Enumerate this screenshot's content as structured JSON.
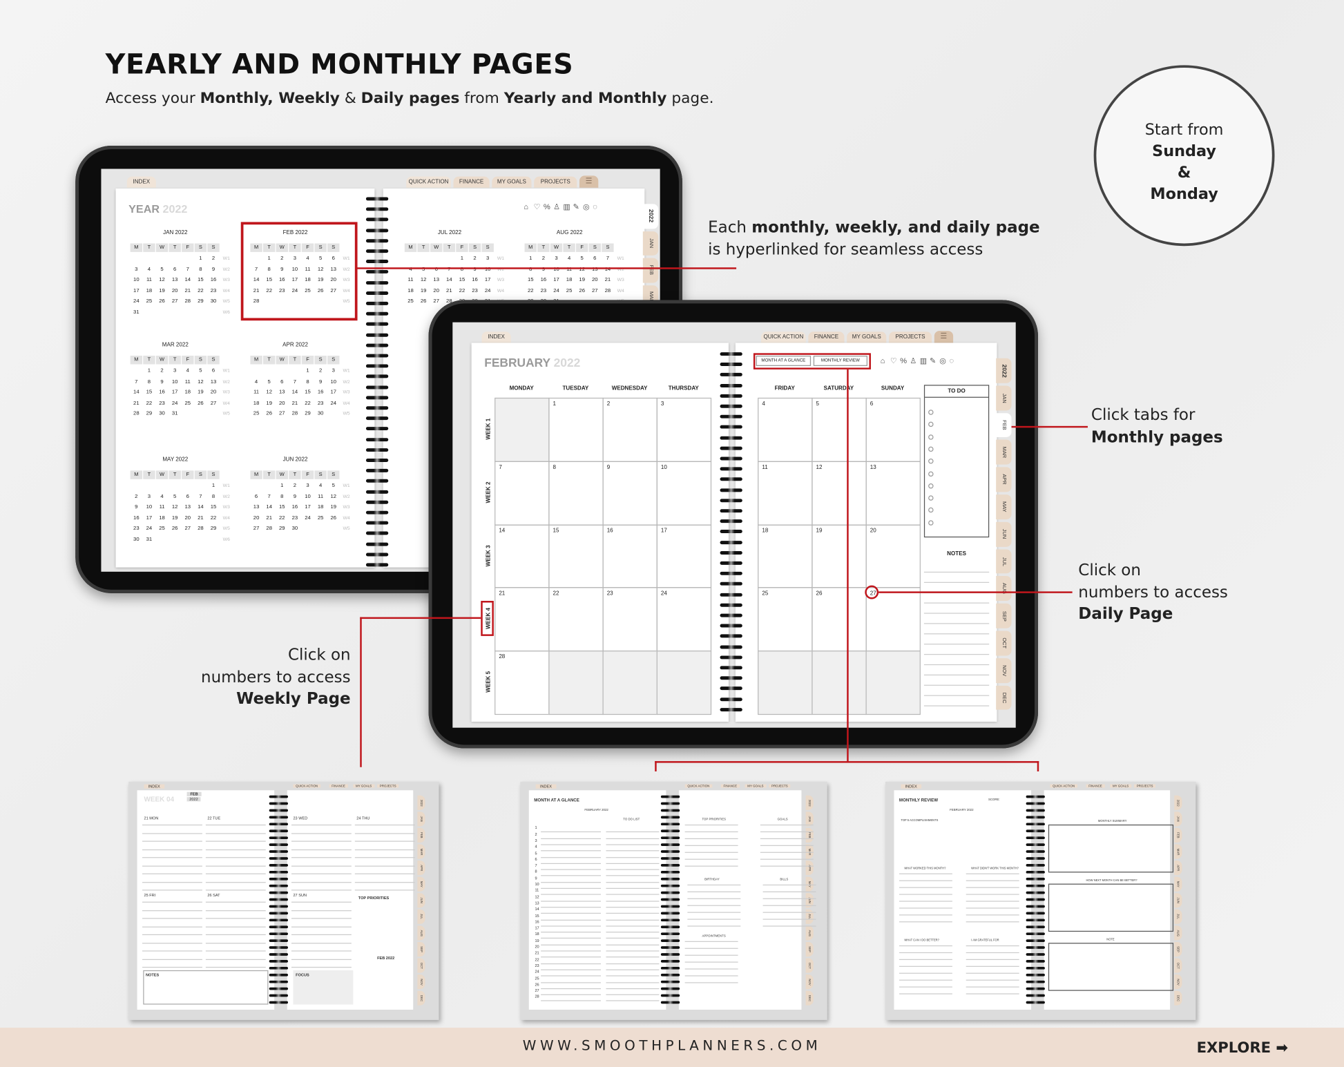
{
  "header": {
    "title": "YEARLY AND MONTHLY PAGES",
    "subtitle_parts": [
      {
        "t": "Access your ",
        "b": false
      },
      {
        "t": "Monthly, Weekly",
        "b": true
      },
      {
        "t": " & ",
        "b": false
      },
      {
        "t": "Daily pages",
        "b": true
      },
      {
        "t": " from ",
        "b": false
      },
      {
        "t": "Yearly and Monthly",
        "b": true
      },
      {
        "t": " page.",
        "b": false
      }
    ]
  },
  "badge": {
    "line1": "Start from",
    "line2": "Sunday",
    "line3": "&",
    "line4": "Monday"
  },
  "callouts": {
    "hyperlink": {
      "l1a": "Each ",
      "l1b": "monthly, weekly, and daily page",
      "l2": "is hyperlinked for seamless access"
    },
    "tabs": {
      "l1": "Click tabs for",
      "l2": "Monthly pages"
    },
    "daily": {
      "l1": "Click on",
      "l2": "numbers to access",
      "l3": "Daily Page"
    },
    "weekly": {
      "l1": "Click on",
      "l2": "numbers to access",
      "l3": "Weekly Page"
    }
  },
  "planner": {
    "top_tabs": {
      "index": "INDEX",
      "quick": "QUICK ACTION",
      "finance": "FINANCE",
      "goals": "MY GOALS",
      "projects": "PROJECTS"
    },
    "side_tabs": [
      "2022",
      "JAN",
      "FEB",
      "MAR",
      "APR",
      "MAY",
      "JUN",
      "JUL",
      "AUG",
      "SEP",
      "OCT",
      "NOV",
      "DEC"
    ],
    "icons": [
      "home-icon",
      "heart-health-icon",
      "pills-icon",
      "flask-icon",
      "chart-icon",
      "notes-icon",
      "target-icon",
      "leaf-icon"
    ],
    "weekdays": [
      "M",
      "T",
      "W",
      "T",
      "F",
      "S",
      "S"
    ],
    "accent": "#c0161c",
    "tab_color": "#ecdccd"
  },
  "yearly": {
    "title": "YEAR",
    "year": "2022",
    "months": [
      {
        "name": "JAN",
        "year": "2022",
        "first_weekday": 5,
        "days": 31
      },
      {
        "name": "FEB",
        "year": "2022",
        "first_weekday": 1,
        "days": 28
      },
      {
        "name": "MAR",
        "year": "2022",
        "first_weekday": 1,
        "days": 31
      },
      {
        "name": "APR",
        "year": "2022",
        "first_weekday": 4,
        "days": 30
      },
      {
        "name": "MAY",
        "year": "2022",
        "first_weekday": 6,
        "days": 31
      },
      {
        "name": "JUN",
        "year": "2022",
        "first_weekday": 2,
        "days": 30
      },
      {
        "name": "JUL",
        "year": "2022",
        "first_weekday": 4,
        "days": 31
      },
      {
        "name": "AUG",
        "year": "2022",
        "first_weekday": 0,
        "days": 31
      }
    ]
  },
  "monthly": {
    "title": "FEBRUARY",
    "year": "2022",
    "buttons": {
      "glance": "MONTH AT A GLANCE",
      "review": "MONTHLY REVIEW"
    },
    "day_headers": [
      "MONDAY",
      "TUESDAY",
      "WEDNESDAY",
      "THURSDAY",
      "FRIDAY",
      "SATURDAY",
      "SUNDAY"
    ],
    "week_labels": [
      "WEEK 1",
      "WEEK 2",
      "WEEK 3",
      "WEEK 4",
      "WEEK 5"
    ],
    "first_weekday": 1,
    "days": 28,
    "todo": "TO DO",
    "notes": "NOTES"
  },
  "thumbs": {
    "weekly": {
      "title": "WEEK 04",
      "month": "FEB",
      "year": "2022",
      "days": [
        "21 MON",
        "22 TUE",
        "23 WED",
        "24 THU",
        "25 FRI",
        "26 SAT",
        "27 SUN"
      ],
      "priorities": "TOP PRIORITIES",
      "notes": "NOTES",
      "focus": "FOCUS",
      "mini": "FEB 2022"
    },
    "glance": {
      "title": "MONTH AT A GLANCE",
      "subtitle": "FEBRUARY 2022",
      "todo": "TO DO LIST",
      "priorities": "TOP PRIORITIES",
      "goals": "GOALS",
      "birthday": "BIRTHDAY",
      "bills": "BILLS",
      "appointments": "APPOINTMENTS"
    },
    "review": {
      "title": "MONTHLY REVIEW",
      "score": "SCORE:",
      "subtitle": "FEBRUARY 2022",
      "acc": "TOP 5 ACCOMPLISHMENTS",
      "worked": "WHAT WORKED THIS MONTH?",
      "didnt": "WHAT DIDN'T WORK THIS MONTH?",
      "better": "WHAT CAN I DO BETTER?",
      "grateful": "I AM GRATEFUL FOR",
      "summary": "MONTHLY SUMMARY",
      "next": "HOW NEXT MONTH CAN BE BETTER?",
      "note": "NOTE"
    }
  },
  "footer": {
    "url": "WWW.SMOOTHPLANNERS.COM",
    "explore": "EXPLORE"
  }
}
